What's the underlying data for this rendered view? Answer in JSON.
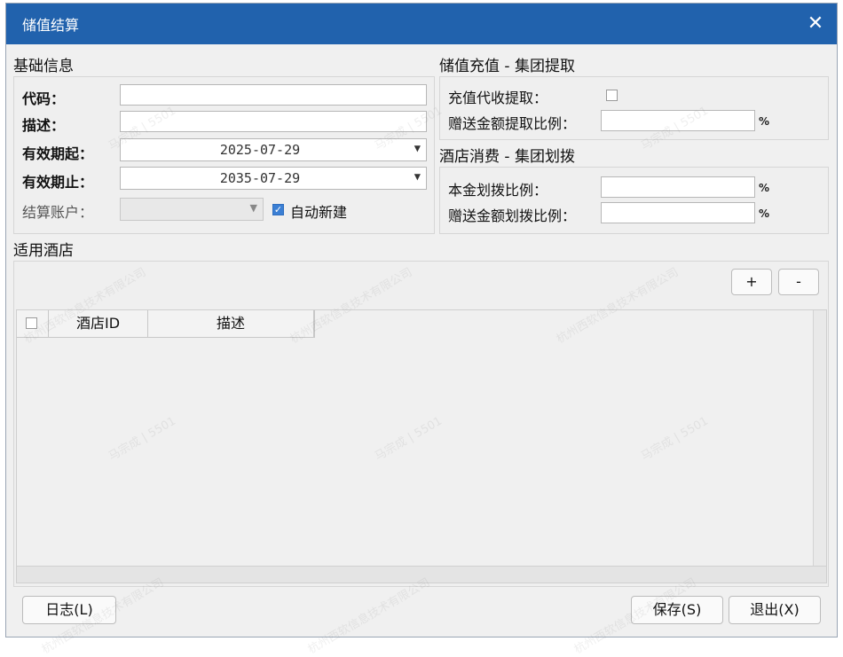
{
  "window": {
    "title": "储值结算",
    "close_icon": "close-icon"
  },
  "basic_info": {
    "section_title": "基础信息",
    "code_label": "代码：",
    "code_value": "",
    "desc_label": "描述：",
    "desc_value": "",
    "valid_from_label": "有效期起：",
    "valid_from_value": "2025-07-29",
    "valid_to_label": "有效期止：",
    "valid_to_value": "2035-07-29",
    "account_label": "结算账户：",
    "auto_create_label": "自动新建",
    "auto_create_checked": true
  },
  "recharge": {
    "section_title": "储值充值 - 集团提取",
    "collect_label": "充值代收提取：",
    "collect_checked": false,
    "gift_ratio_label": "赠送金额提取比例：",
    "gift_ratio_value": "",
    "percent": "%"
  },
  "hotel_consume": {
    "section_title": "酒店消费 - 集团划拨",
    "principal_ratio_label": "本金划拨比例：",
    "principal_ratio_value": "",
    "gift_ratio_label": "赠送金额划拨比例：",
    "gift_ratio_value": "",
    "percent": "%"
  },
  "hotels": {
    "section_title": "适用酒店",
    "add_label": "+",
    "remove_label": "-",
    "columns": [
      "酒店ID",
      "描述"
    ],
    "rows": []
  },
  "footer": {
    "log_label": "日志(L)",
    "save_label": "保存(S)",
    "exit_label": "退出(X)"
  },
  "watermark": {
    "line1": "马宗成 | 5501",
    "line2": "杭州西软信息技术有限公司"
  }
}
